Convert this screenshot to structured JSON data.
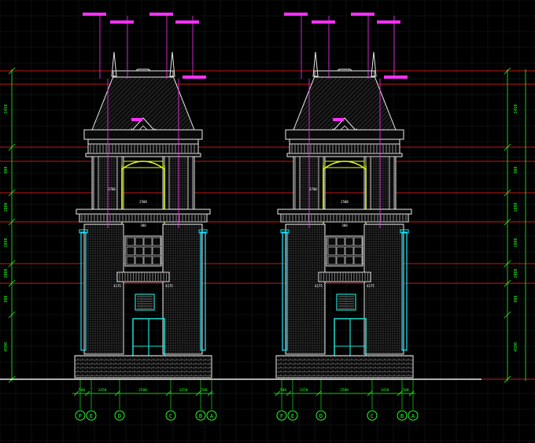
{
  "colors": {
    "background": "#000000",
    "grid": "#1f2a2a",
    "outline": "#e8e8e8",
    "level_line": "#ff2020",
    "leader": "#ff30ff",
    "column": "#19e6ff",
    "window_frame": "#1ee0d0",
    "dimension": "#20ff20",
    "dimension_text": "#20ff20",
    "structure": "#e0ff20",
    "hatch": "#8a8a8a",
    "annotation": "#ffffff"
  },
  "vertical_dims": {
    "left": [
      "3450",
      "900",
      "1800",
      "1000",
      "2000",
      "800",
      "4500"
    ],
    "right": [
      "3450",
      "900",
      "1800",
      "1000",
      "2000",
      "800",
      "4500"
    ]
  },
  "elevations": [
    {
      "id": "left",
      "dims_bottom": [
        "500",
        "1450",
        "2500",
        "1450",
        "500"
      ],
      "axes": [
        "F",
        "E",
        "D",
        "C",
        "B",
        "A"
      ],
      "labels": {
        "mid_left": "3700",
        "mid_center": "2500",
        "center_label": "4175",
        "bottom_label": "300"
      }
    },
    {
      "id": "right",
      "dims_bottom": [
        "500",
        "1450",
        "2500",
        "1450",
        "500"
      ],
      "axes": [
        "F",
        "E",
        "D",
        "C",
        "B",
        "A"
      ],
      "labels": {
        "mid_left": "3700",
        "mid_center": "2500",
        "center_label": "4175",
        "bottom_label": "300"
      }
    }
  ]
}
